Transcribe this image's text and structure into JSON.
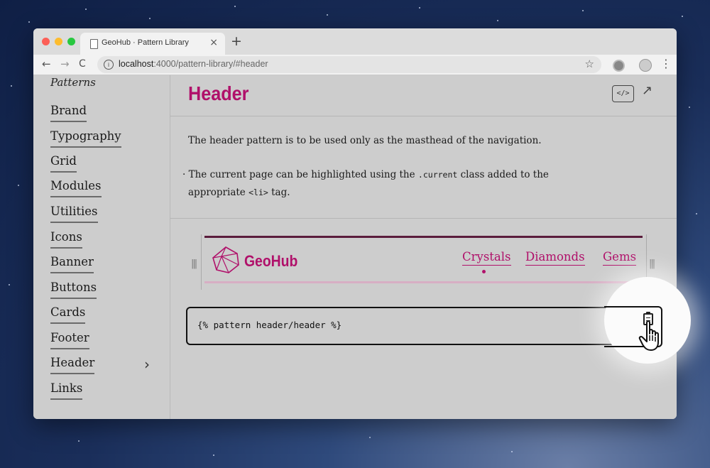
{
  "browser": {
    "tab_title": "GeoHub · Pattern Library",
    "tab_close": "×",
    "new_tab": "+",
    "url_host": "localhost",
    "url_path": ":4000/pattern-library/#header",
    "back": "←",
    "forward": "→",
    "reload": "C",
    "bookmark": "☆",
    "menu": "⋮",
    "info": "i"
  },
  "sidebar": {
    "title": "Patterns",
    "items": [
      {
        "label": "Brand"
      },
      {
        "label": "Typography"
      },
      {
        "label": "Grid"
      },
      {
        "label": "Modules"
      },
      {
        "label": "Utilities"
      },
      {
        "label": "Icons"
      },
      {
        "label": "Banner"
      },
      {
        "label": "Buttons"
      },
      {
        "label": "Cards"
      },
      {
        "label": "Footer"
      },
      {
        "label": "Header"
      },
      {
        "label": "Links"
      }
    ],
    "chevron": "›"
  },
  "main": {
    "title": "Header",
    "code_toggle": "</>",
    "open_external": "↗",
    "description": "The header pattern is to be used only as the masthead of the navigation.",
    "note": {
      "bullet": "·",
      "before": "The current page can be highlighted using the",
      "code_class": ".current",
      "middle": "class added to the",
      "before2": "appropriate",
      "code_tag": "<li>",
      "after": "tag."
    }
  },
  "demo": {
    "logo_text": "GeoHub",
    "nav": [
      {
        "label": "Crystals"
      },
      {
        "label": "Diamonds"
      },
      {
        "label": "Gems"
      }
    ],
    "handle": "|||"
  },
  "snippet": {
    "code": "{% pattern header/header %}"
  },
  "colors": {
    "accent": "#b0106a",
    "accent_dark": "#5a1c3c",
    "accent_light": "#d7aec4"
  }
}
